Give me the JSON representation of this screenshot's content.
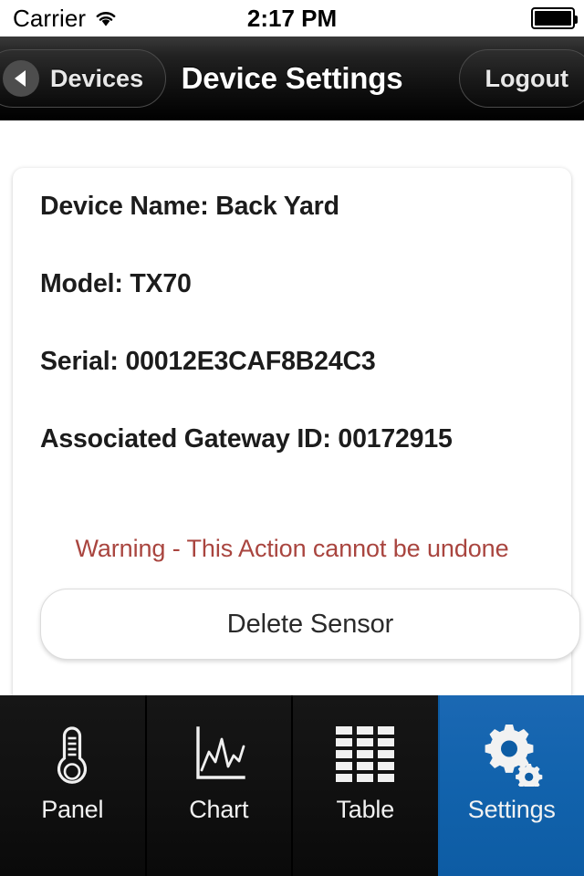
{
  "status_bar": {
    "carrier": "Carrier",
    "wifi_icon": "wifi-icon",
    "time": "2:17 PM",
    "battery_icon": "battery-full-icon"
  },
  "nav_bar": {
    "back_button": {
      "label": "Devices",
      "icon": "chevron-left-icon"
    },
    "title": "Device Settings",
    "logout_button": {
      "label": "Logout"
    }
  },
  "card": {
    "fields": [
      {
        "text": "Device Name: Back Yard"
      },
      {
        "text": "Model: TX70"
      },
      {
        "text": "Serial: 00012E3CAF8B24C3"
      },
      {
        "text": "Associated Gateway ID: 00172915"
      }
    ],
    "warning": "Warning - This Action cannot be undone",
    "warning_color": "#a9453f",
    "delete_button": {
      "label": "Delete Sensor"
    }
  },
  "tab_bar": {
    "active_color": "#0d5ca4",
    "items": [
      {
        "label": "Panel",
        "icon": "thermometer-icon",
        "active": false
      },
      {
        "label": "Chart",
        "icon": "line-chart-icon",
        "active": false
      },
      {
        "label": "Table",
        "icon": "table-grid-icon",
        "active": false
      },
      {
        "label": "Settings",
        "icon": "gears-icon",
        "active": true
      }
    ]
  }
}
